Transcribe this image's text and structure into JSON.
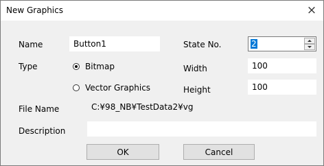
{
  "dialog": {
    "title": "New Graphics",
    "close_label": "×"
  },
  "fields": {
    "name_label": "Name",
    "name_value": "Button1",
    "state_label": "State No.",
    "state_value": "2",
    "type_label": "Type",
    "width_label": "Width",
    "width_value": "100",
    "height_label": "Height",
    "height_value": "100",
    "file_name_label": "File Name",
    "file_name_value": "C:¥98_NB¥TestData2¥vg",
    "description_label": "Description",
    "description_value": ""
  },
  "type_options": [
    {
      "label": "Bitmap",
      "selected": true
    },
    {
      "label": "Vector Graphics",
      "selected": false
    }
  ],
  "buttons": {
    "ok": "OK",
    "cancel": "Cancel"
  }
}
